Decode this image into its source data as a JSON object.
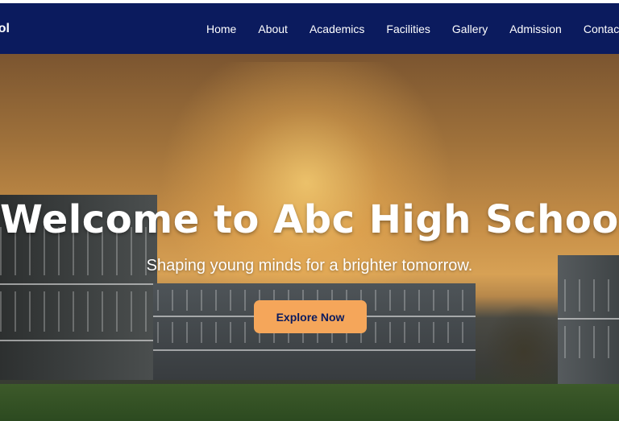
{
  "brand": {
    "name": "Abc High School"
  },
  "nav": {
    "items": [
      "Home",
      "About",
      "Academics",
      "Facilities",
      "Gallery",
      "Admission",
      "Contact"
    ]
  },
  "hero": {
    "title": "Welcome to Abc High School",
    "subtitle": "Shaping young minds for a brighter tomorrow.",
    "cta_label": "Explore Now"
  },
  "colors": {
    "navbar": "#0b1b5e",
    "cta_background": "#f5a65a",
    "cta_text": "#0b1b5e",
    "hero_text": "#ffffff"
  }
}
